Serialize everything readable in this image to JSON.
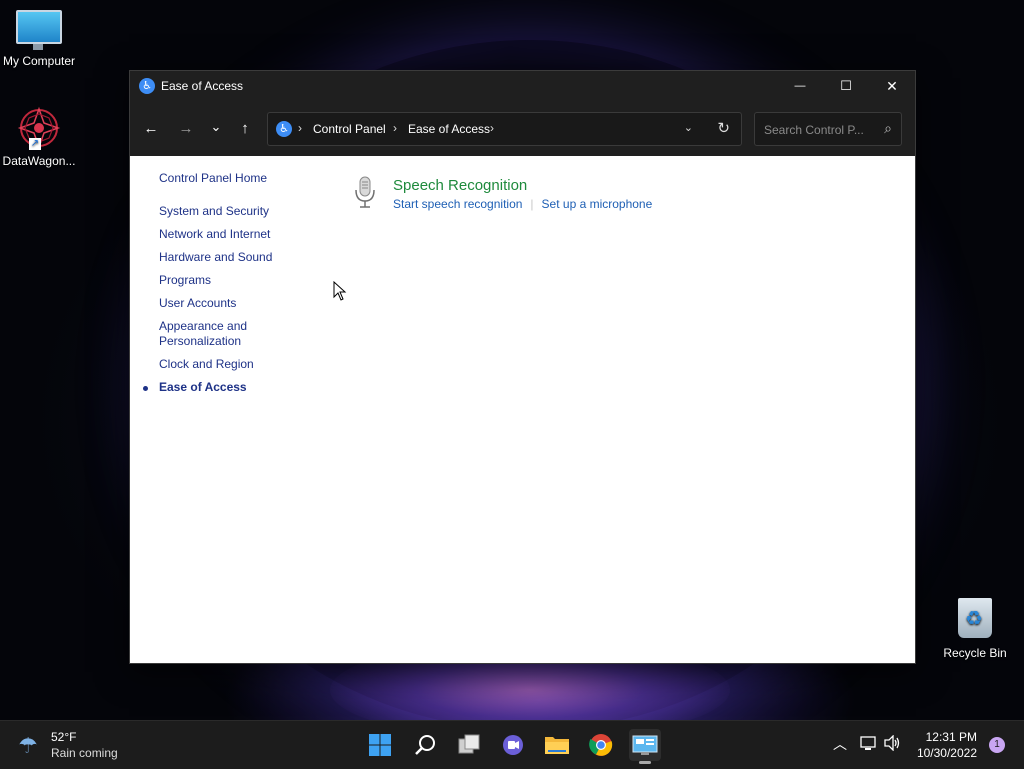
{
  "desktop": {
    "icons": [
      {
        "label": "My Computer"
      },
      {
        "label": "DataWagon..."
      },
      {
        "label": "Recycle Bin"
      }
    ]
  },
  "window": {
    "title": "Ease of Access",
    "buttons": {
      "minimize": "—",
      "maximize": "☐",
      "close": "✕"
    }
  },
  "navigation": {
    "back": "←",
    "forward": "→",
    "recent": "⌄",
    "up": "↑",
    "breadcrumbs": [
      "Control Panel",
      "Ease of Access"
    ],
    "search_placeholder": "Search Control P...",
    "refresh": "↻",
    "dropdown": "⌄"
  },
  "sidebar": {
    "home": "Control Panel Home",
    "items": [
      {
        "label": "System and Security"
      },
      {
        "label": "Network and Internet"
      },
      {
        "label": "Hardware and Sound"
      },
      {
        "label": "Programs"
      },
      {
        "label": "User Accounts"
      },
      {
        "label": "Appearance and Personalization"
      },
      {
        "label": "Clock and Region"
      },
      {
        "label": "Ease of Access",
        "current": true
      }
    ]
  },
  "main": {
    "section_title": "Speech Recognition",
    "links": [
      "Start speech recognition",
      "Set up a microphone"
    ]
  },
  "taskbar": {
    "weather": {
      "temp": "52°F",
      "condition": "Rain coming"
    },
    "time": "12:31 PM",
    "date": "10/30/2022",
    "notification_count": "1"
  },
  "colors": {
    "titlebar": "#1f1f1f",
    "link": "#1e3287",
    "section_title": "#1e8a3c",
    "sub_link": "#1e5fb4",
    "accent": "#3d8df5"
  }
}
